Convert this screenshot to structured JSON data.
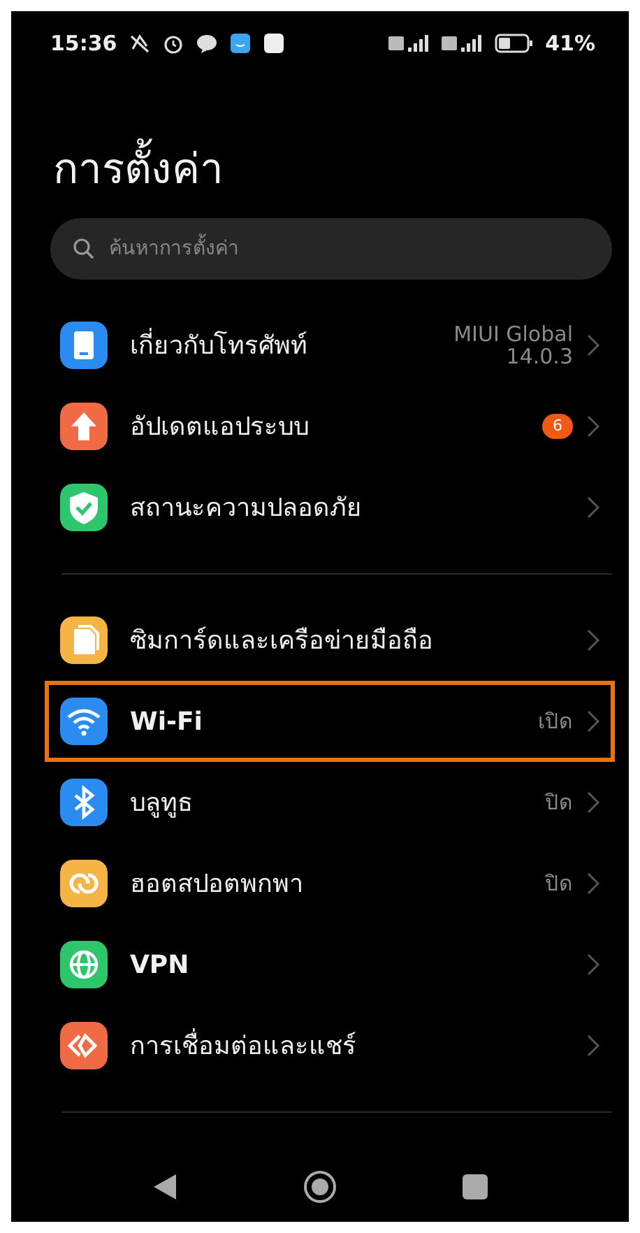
{
  "status_bar": {
    "time": "15:36",
    "battery": "41%"
  },
  "title": "การตั้งค่า",
  "search": {
    "placeholder": "ค้นหาการตั้งค่า"
  },
  "groups": [
    {
      "items": [
        {
          "kind": "phone",
          "color": "#2a8cf0",
          "label": "เกี่ยวกับโทรศัพท์",
          "value": "MIUI Global\n14.0.3",
          "highlighted": false
        },
        {
          "kind": "update",
          "color": "#f06a45",
          "label": "อัปเดตแอประบบ",
          "badge": "6",
          "highlighted": false
        },
        {
          "kind": "shield",
          "color": "#2dc66d",
          "label": "สถานะความปลอดภัย",
          "highlighted": false
        }
      ]
    },
    {
      "items": [
        {
          "kind": "sim",
          "color": "#f5b544",
          "label": "ซิมการ์ดและเครือข่ายมือถือ",
          "highlighted": false
        },
        {
          "kind": "wifi",
          "color": "#2a8cf0",
          "label": "Wi-Fi",
          "value": "เปิด",
          "highlighted": true
        },
        {
          "kind": "bluetooth",
          "color": "#2a8cf0",
          "label": "บลูทูธ",
          "value": "ปิด",
          "highlighted": false
        },
        {
          "kind": "hotspot",
          "color": "#f5b544",
          "label": "ฮอตสปอตพกพา",
          "value": "ปิด",
          "highlighted": false
        },
        {
          "kind": "vpn",
          "color": "#2dc66d",
          "label": "VPN",
          "highlighted": false
        },
        {
          "kind": "share",
          "color": "#f06a45",
          "label": "การเชื่อมต่อและแชร์",
          "highlighted": false
        }
      ]
    }
  ]
}
